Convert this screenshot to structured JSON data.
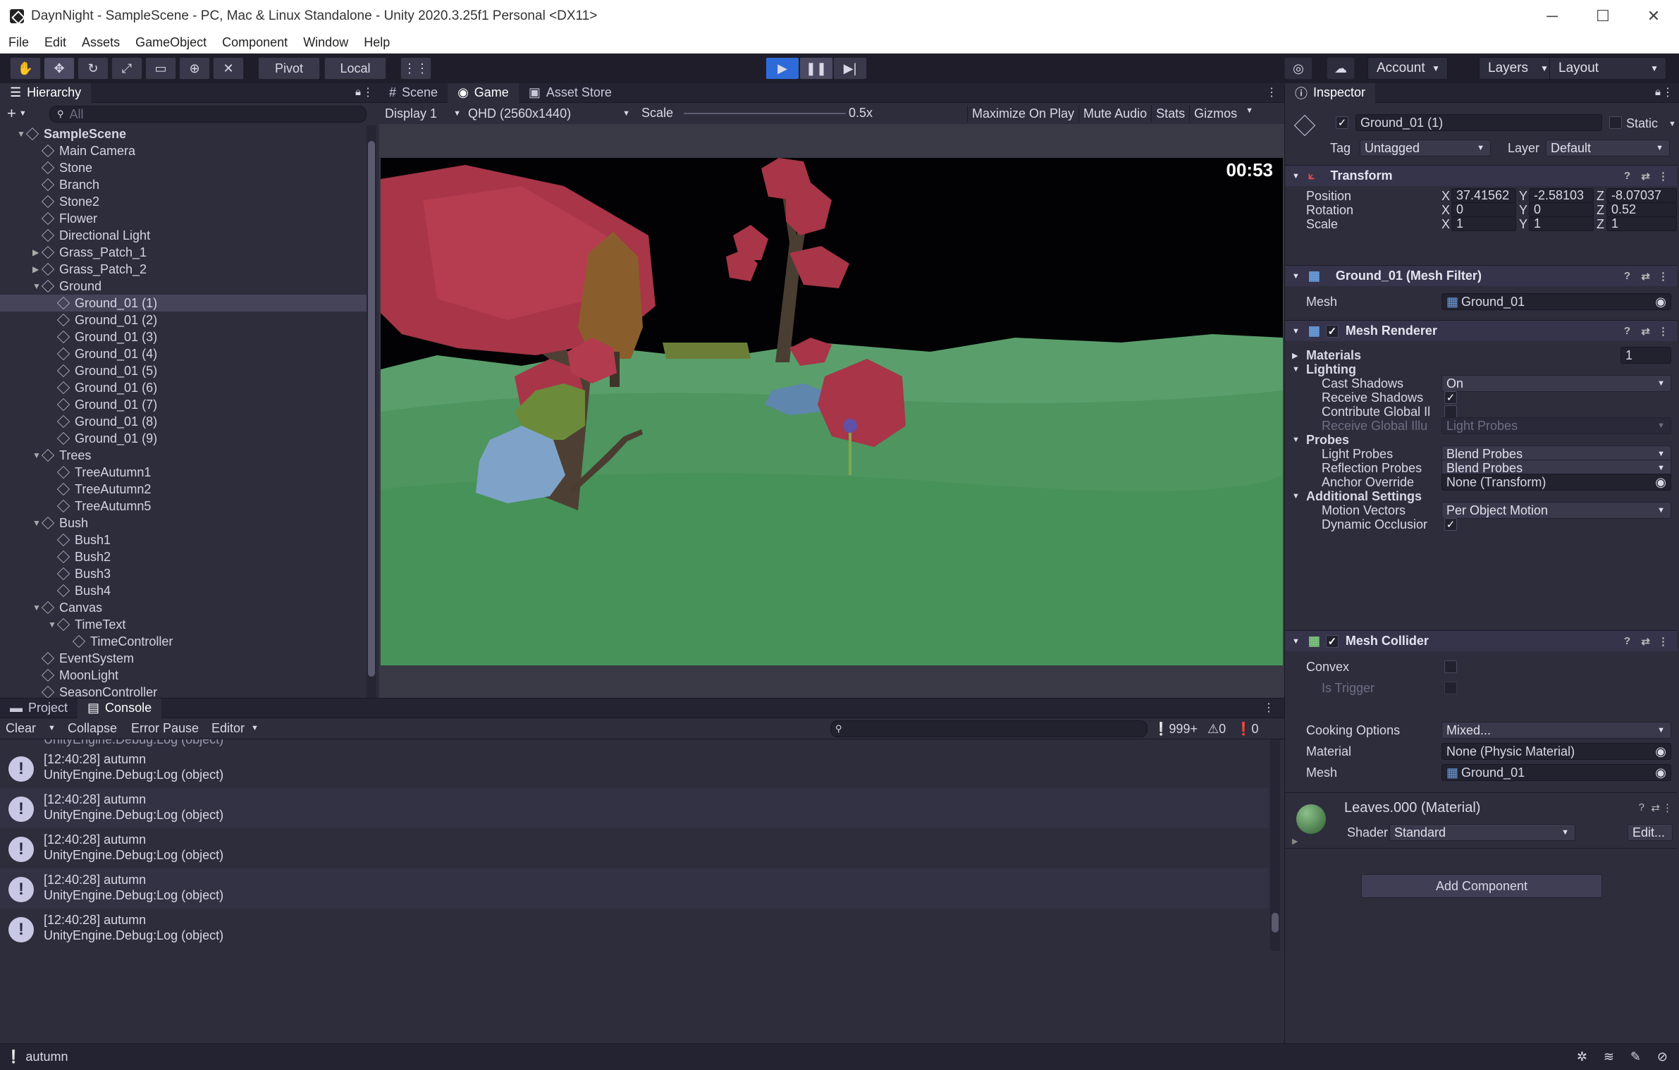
{
  "window": {
    "title": "DaynNight - SampleScene - PC, Mac & Linux Standalone - Unity 2020.3.25f1 Personal <DX11>",
    "minimize": "─",
    "maximize": "☐",
    "close": "✕"
  },
  "menu": [
    "File",
    "Edit",
    "Assets",
    "GameObject",
    "Component",
    "Window",
    "Help"
  ],
  "toolbar": {
    "pivot": "Pivot",
    "local": "Local",
    "account": "Account",
    "layers": "Layers",
    "layout": "Layout",
    "tool_icons": [
      "hand-tool-icon",
      "move-tool-icon",
      "rotate-tool-icon",
      "scale-tool-icon",
      "rect-tool-icon",
      "transform-tool-icon",
      "custom-tool-icon"
    ],
    "play_icon": "▶",
    "pause_icon": "❚❚",
    "step_icon": "▶|"
  },
  "hierarchy": {
    "tab": "Hierarchy",
    "search_placeholder": "All",
    "add": "+",
    "items": [
      {
        "label": "SampleScene",
        "depth": 0,
        "expand": "▼",
        "scene": true
      },
      {
        "label": "Main Camera",
        "depth": 1
      },
      {
        "label": "Stone",
        "depth": 1
      },
      {
        "label": "Branch",
        "depth": 1
      },
      {
        "label": "Stone2",
        "depth": 1
      },
      {
        "label": "Flower",
        "depth": 1
      },
      {
        "label": "Directional Light",
        "depth": 1
      },
      {
        "label": "Grass_Patch_1",
        "depth": 1,
        "expand": "▶"
      },
      {
        "label": "Grass_Patch_2",
        "depth": 1,
        "expand": "▶"
      },
      {
        "label": "Ground",
        "depth": 1,
        "expand": "▼"
      },
      {
        "label": "Ground_01 (1)",
        "depth": 2,
        "selected": true
      },
      {
        "label": "Ground_01 (2)",
        "depth": 2
      },
      {
        "label": "Ground_01 (3)",
        "depth": 2
      },
      {
        "label": "Ground_01 (4)",
        "depth": 2
      },
      {
        "label": "Ground_01 (5)",
        "depth": 2
      },
      {
        "label": "Ground_01 (6)",
        "depth": 2
      },
      {
        "label": "Ground_01 (7)",
        "depth": 2
      },
      {
        "label": "Ground_01 (8)",
        "depth": 2
      },
      {
        "label": "Ground_01 (9)",
        "depth": 2
      },
      {
        "label": "Trees",
        "depth": 1,
        "expand": "▼"
      },
      {
        "label": "TreeAutumn1",
        "depth": 2
      },
      {
        "label": "TreeAutumn2",
        "depth": 2
      },
      {
        "label": "TreeAutumn5",
        "depth": 2
      },
      {
        "label": "Bush",
        "depth": 1,
        "expand": "▼"
      },
      {
        "label": "Bush1",
        "depth": 2
      },
      {
        "label": "Bush2",
        "depth": 2
      },
      {
        "label": "Bush3",
        "depth": 2
      },
      {
        "label": "Bush4",
        "depth": 2
      },
      {
        "label": "Canvas",
        "depth": 1,
        "expand": "▼"
      },
      {
        "label": "TimeText",
        "depth": 2,
        "expand": "▼"
      },
      {
        "label": "TimeController",
        "depth": 3
      },
      {
        "label": "EventSystem",
        "depth": 1
      },
      {
        "label": "MoonLight",
        "depth": 1
      },
      {
        "label": "SeasonController",
        "depth": 1
      }
    ]
  },
  "game": {
    "tabs": [
      "Scene",
      "Game",
      "Asset Store"
    ],
    "display": "Display 1",
    "resolution": "QHD (2560x1440)",
    "scale_label": "Scale",
    "scale_value": "0.5x",
    "buttons": [
      "Maximize On Play",
      "Mute Audio",
      "Stats",
      "Gizmos"
    ],
    "timer": "00:53"
  },
  "console": {
    "tabs": [
      "Project",
      "Console"
    ],
    "clear": "Clear",
    "collapse": "Collapse",
    "error_pause": "Error Pause",
    "editor": "Editor",
    "count_log": "999+",
    "count_warn": "0",
    "count_error": "0",
    "entries": [
      {
        "line1": "[12:40:28] autumn",
        "line2": "UnityEngine.Debug:Log (object)"
      },
      {
        "line1": "[12:40:28] autumn",
        "line2": "UnityEngine.Debug:Log (object)"
      },
      {
        "line1": "[12:40:28] autumn",
        "line2": "UnityEngine.Debug:Log (object)"
      },
      {
        "line1": "[12:40:28] autumn",
        "line2": "UnityEngine.Debug:Log (object)"
      },
      {
        "line1": "[12:40:28] autumn",
        "line2": "UnityEngine.Debug:Log (object)"
      }
    ],
    "partial_top": "UnityEngine.Debug:Log (object)"
  },
  "status": {
    "message": "autumn"
  },
  "inspector": {
    "tab": "Inspector",
    "object_name": "Ground_01 (1)",
    "static": "Static",
    "tag_label": "Tag",
    "tag": "Untagged",
    "layer_label": "Layer",
    "layer": "Default",
    "transform": {
      "title": "Transform",
      "position": "Position",
      "rotation": "Rotation",
      "scale": "Scale",
      "pos": [
        "37.41562",
        "-2.58103",
        "-8.07037"
      ],
      "rot": [
        "0",
        "0",
        "0.52"
      ],
      "scl": [
        "1",
        "1",
        "1"
      ],
      "x": "X",
      "y": "Y",
      "z": "Z"
    },
    "mesh_filter": {
      "title": "Ground_01 (Mesh Filter)",
      "mesh_label": "Mesh",
      "mesh": "Ground_01"
    },
    "mesh_renderer": {
      "title": "Mesh Renderer",
      "materials": "Materials",
      "materials_count": "1",
      "lighting": "Lighting",
      "cast_shadows": "Cast Shadows",
      "cast_shadows_value": "On",
      "receive_shadows": "Receive Shadows",
      "contribute_gi": "Contribute Global Il",
      "receive_gi": "Receive Global Illu",
      "receive_gi_value": "Light Probes",
      "probes": "Probes",
      "light_probes": "Light Probes",
      "light_probes_value": "Blend Probes",
      "reflection_probes": "Reflection Probes",
      "reflection_probes_value": "Blend Probes",
      "anchor_override": "Anchor Override",
      "anchor_override_value": "None (Transform)",
      "additional": "Additional Settings",
      "motion_vectors": "Motion Vectors",
      "motion_vectors_value": "Per Object Motion",
      "dynamic_occlusion": "Dynamic Occlusior"
    },
    "mesh_collider": {
      "title": "Mesh Collider",
      "convex": "Convex",
      "is_trigger": "Is Trigger",
      "cooking": "Cooking Options",
      "cooking_value": "Mixed...",
      "material": "Material",
      "material_value": "None (Physic Material)",
      "mesh": "Mesh",
      "mesh_value": "Ground_01"
    },
    "material": {
      "title": "Leaves.000 (Material)",
      "shader_label": "Shader",
      "shader": "Standard",
      "edit": "Edit..."
    },
    "add_component": "Add Component"
  }
}
